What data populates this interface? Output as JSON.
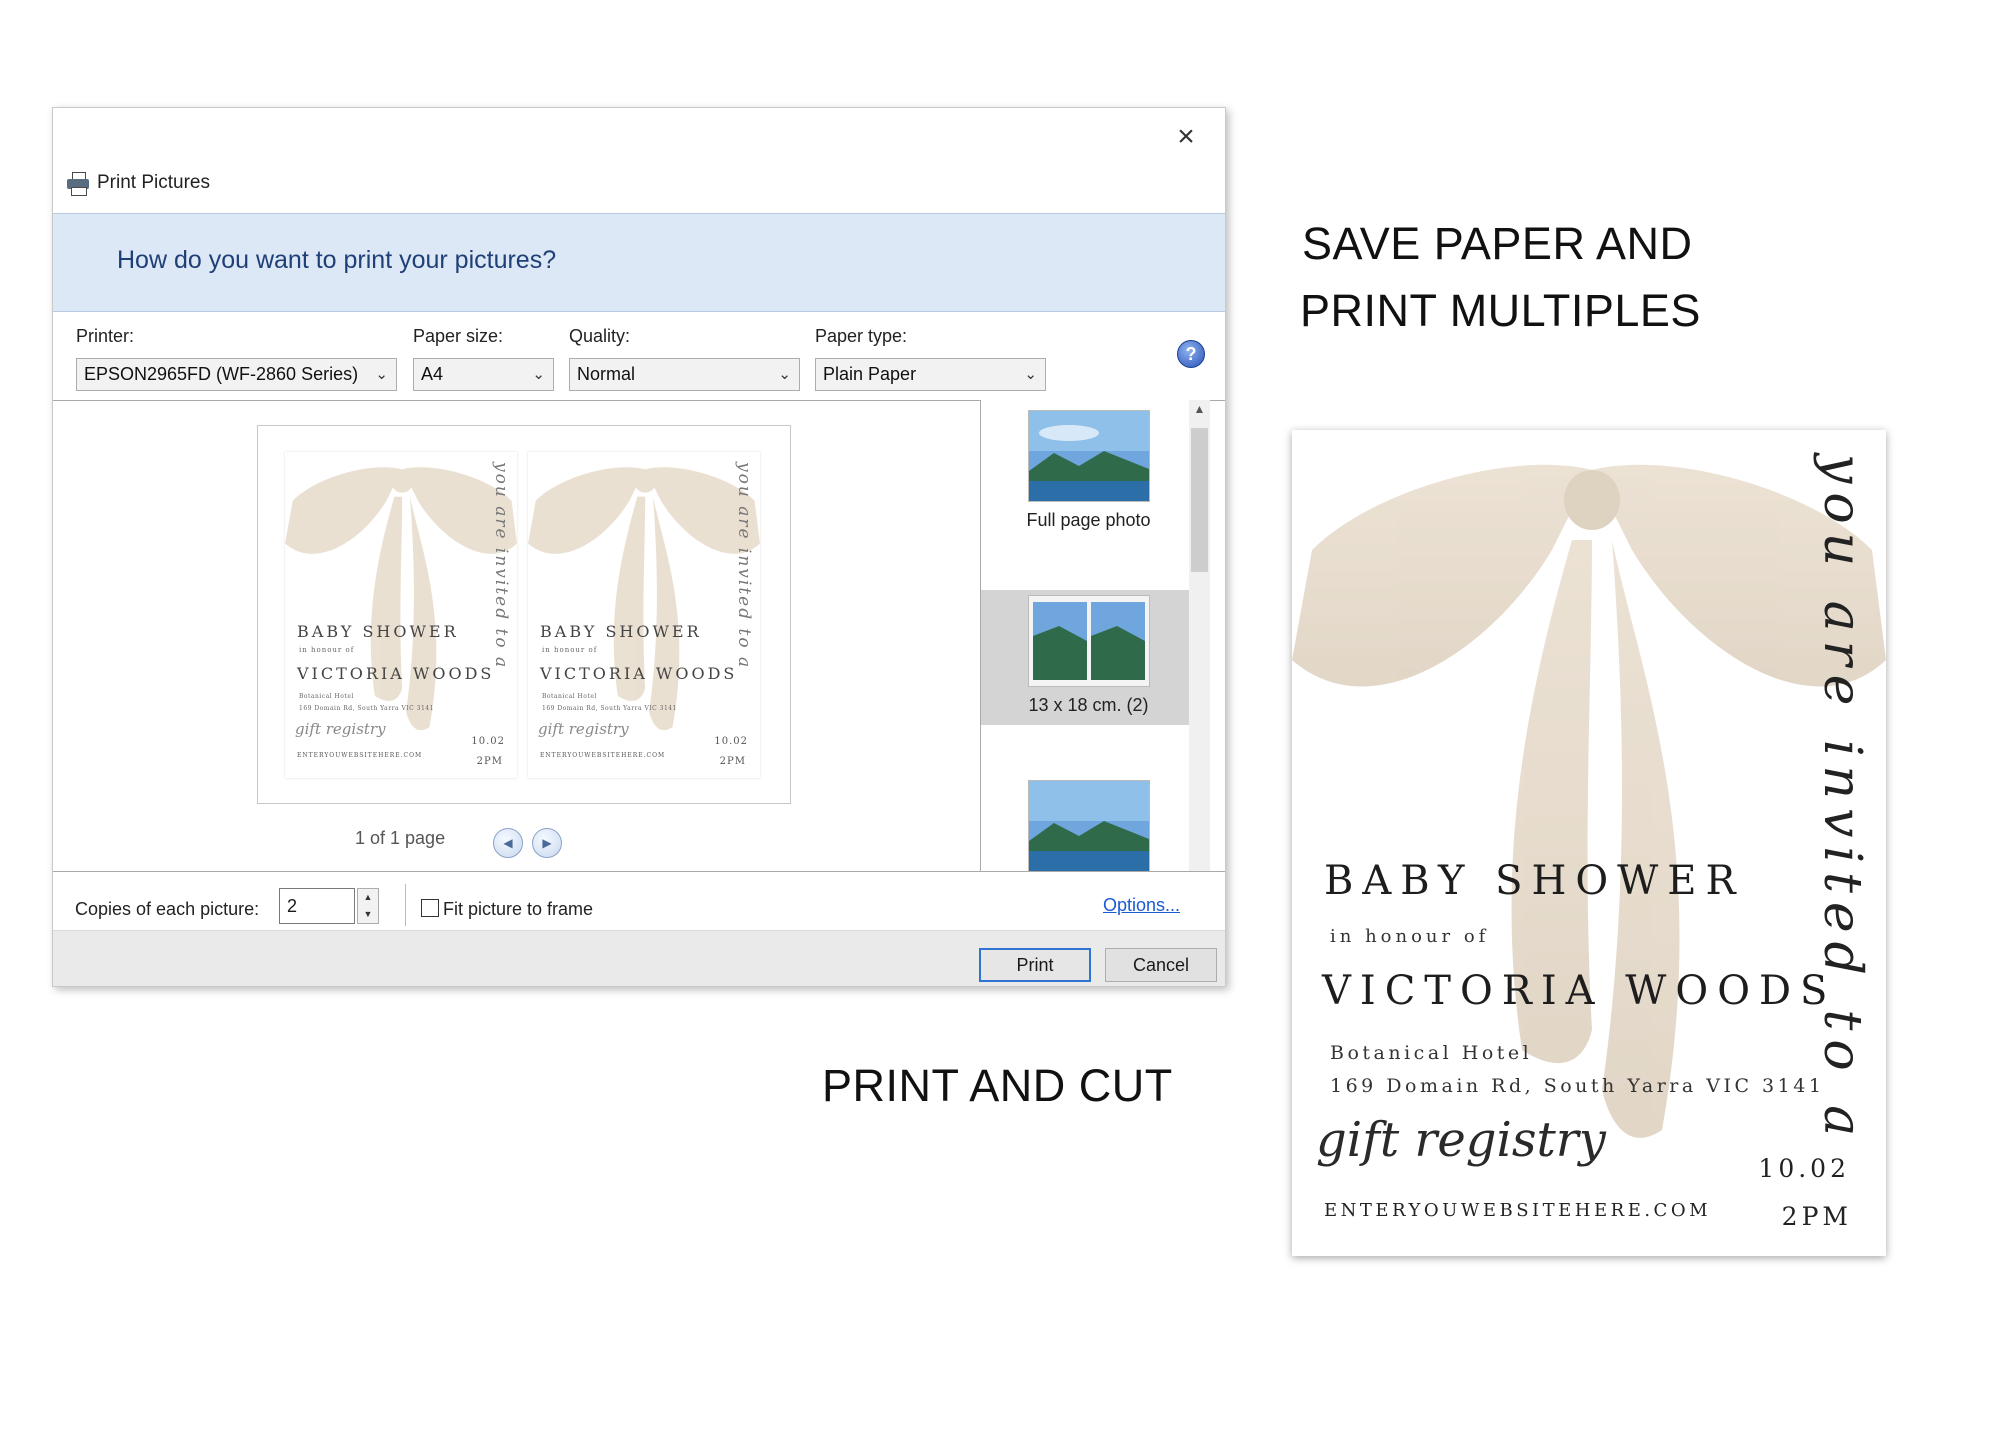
{
  "dialog": {
    "title": "Print Pictures",
    "close_label": "×",
    "question": "How do you want to print your pictures?",
    "printer": {
      "label": "Printer:",
      "value": "EPSON2965FD (WF-2860 Series)"
    },
    "paper_size": {
      "label": "Paper size:",
      "value": "A4"
    },
    "quality": {
      "label": "Quality:",
      "value": "Normal"
    },
    "paper_type": {
      "label": "Paper type:",
      "value": "Plain Paper"
    },
    "help_label": "?",
    "pager": {
      "text": "1 of 1 page",
      "prev_glyph": "◀",
      "next_glyph": "▶"
    },
    "layouts": [
      {
        "label": "Full page photo",
        "selected": false
      },
      {
        "label": "13 x 18 cm. (2)",
        "selected": true
      },
      {
        "label": "",
        "selected": false
      }
    ],
    "copies": {
      "label": "Copies of each picture:",
      "value": "2"
    },
    "fit_to_frame": {
      "label": "Fit picture to frame",
      "checked": false
    },
    "options_link": "Options...",
    "buttons": {
      "print": "Print",
      "cancel": "Cancel"
    }
  },
  "captions": {
    "top_line_1": "SAVE PAPER AND",
    "top_line_2": "PRINT MULTIPLES",
    "bottom": "PRINT AND CUT"
  },
  "invitation": {
    "vertical_text": "you are invited to a",
    "title": "BABY SHOWER",
    "honour": "in honour of",
    "name": "VICTORIA WOODS",
    "venue": "Botanical Hotel",
    "address": "169 Domain Rd, South Yarra VIC 3141",
    "registry": "gift registry",
    "date": "10.02",
    "time": "2PM",
    "website": "ENTERYOUWEBSITEHERE.COM"
  },
  "mini_invitation": {
    "vertical_text": "you are invited to a",
    "title": "BABY SHOWER",
    "honour": "in honour of",
    "name": "VICTORIA WOODS",
    "venue": "Botanical Hotel",
    "address": "169 Domain Rd, South Yarra VIC 3141",
    "registry": "gift registry",
    "date": "10.02",
    "time": "2PM",
    "website": "ENTERYOUWEBSITEHERE.COM"
  },
  "colors": {
    "banner_bg": "#dde8f6",
    "banner_text": "#1f3f77",
    "link": "#1a5bd1",
    "print_button_border": "#2f74d0",
    "bow": "#e8dccd"
  }
}
